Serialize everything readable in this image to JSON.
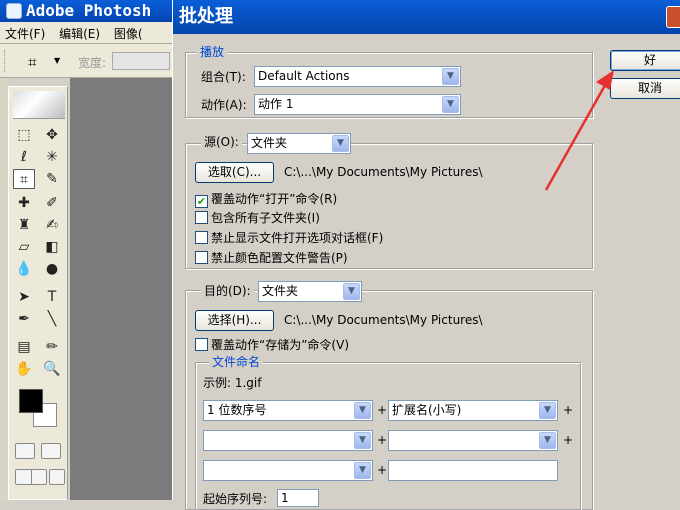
{
  "photoshop": {
    "title": "Adobe Photosh",
    "menu": [
      "文件(F)",
      "编辑(E)",
      "图像("
    ],
    "options": {
      "width_label": "宽度:"
    }
  },
  "dialog": {
    "title": "批处理",
    "ok_label": "好",
    "cancel_label": "取消",
    "play": {
      "legend": "播放",
      "set_label": "组合(T):",
      "set_value": "Default Actions",
      "action_label": "动作(A):",
      "action_value": "动作 1"
    },
    "source": {
      "label": "源(O):",
      "value": "文件夹",
      "choose_label": "选取(C)...",
      "path": "C:\\...\\My Documents\\My Pictures\\",
      "options": [
        {
          "label": "覆盖动作“打开”命令(R)",
          "checked": true
        },
        {
          "label": "包含所有子文件夹(I)",
          "checked": false
        },
        {
          "label": "禁止显示文件打开选项对话框(F)",
          "checked": false
        },
        {
          "label": "禁止颜色配置文件警告(P)",
          "checked": false
        }
      ]
    },
    "destination": {
      "label": "目的(D):",
      "value": "文件夹",
      "choose_label": "选择(H)...",
      "path": "C:\\...\\My Documents\\My Pictures\\",
      "override_label": "覆盖动作“存储为”命令(V)",
      "override_checked": false,
      "naming": {
        "legend": "文件命名",
        "example": "示例: 1.gif",
        "fields": [
          "1 位数序号",
          "扩展名(小写)",
          "",
          "",
          "",
          ""
        ],
        "plus": "+",
        "start_serial_label": "起始序列号:",
        "start_serial_value": "1"
      }
    }
  },
  "colors": {
    "title_bar": "#0a5fd8",
    "dialog_bg": "#d4d0c8",
    "annotation_arrow": "#e53030"
  }
}
